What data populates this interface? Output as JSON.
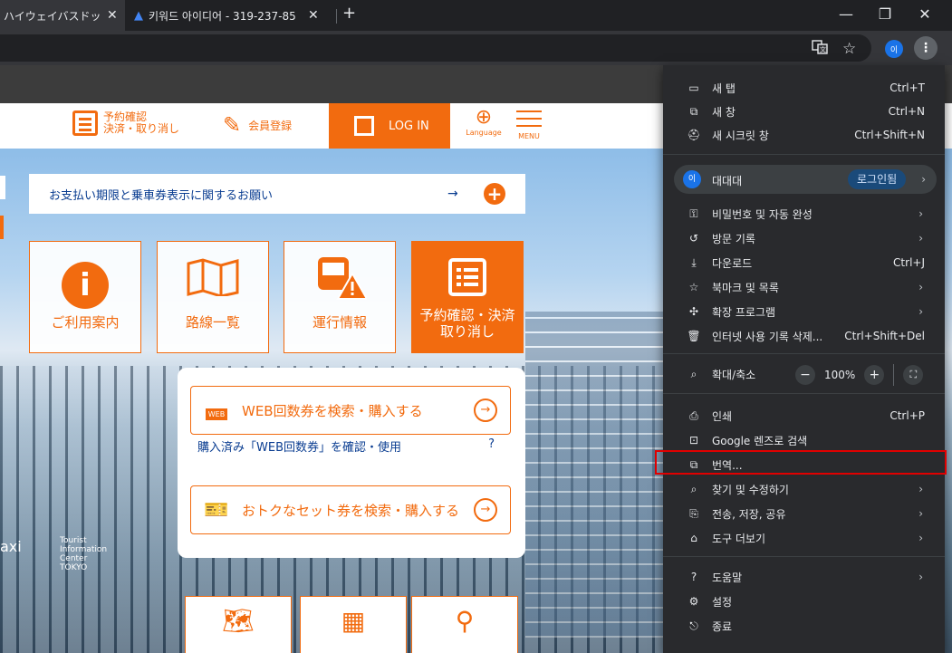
{
  "browser": {
    "tabs": [
      {
        "title": "ハイウェイバスドットコム",
        "close": "✕"
      },
      {
        "title": "키워드 아이디어 - 319-237-85",
        "close": "✕"
      }
    ],
    "new_tab": "+",
    "window": {
      "minimize": "—",
      "restore": "❐",
      "close": "✕"
    },
    "toolbar": {
      "translate_icon": "translate-icon",
      "star_icon": "star-icon",
      "avatar": "이",
      "menu": "⋮"
    }
  },
  "site": {
    "header": {
      "reserve_line1": "予約確認",
      "reserve_line2": "決済・取り消し",
      "member": "会員登録",
      "login": "LOG IN",
      "language": "Language",
      "menu": "MENU"
    },
    "notice": {
      "text": "お支払い期限と乗車券表示に関するお願い",
      "arrow": "→",
      "plus": "+"
    },
    "cards": [
      {
        "label": "ご利用案内",
        "icon": "i"
      },
      {
        "label": "路線一覧",
        "icon": "map-icon"
      },
      {
        "label": "運行情報",
        "icon": "bus-warning-icon"
      },
      {
        "label_line1": "予約確認・決済",
        "label_line2": "取り消し",
        "icon": "list-icon"
      }
    ],
    "panel": {
      "web_ticket": "WEB回数券を検索・購入する",
      "web_ticket_icon": "WEB",
      "purchased_link": "購入済み「WEB回数券」を確認・使用",
      "help": "?",
      "set_ticket": "おトクなセット券を検索・購入する",
      "go": "→"
    },
    "background_text": {
      "taxi": "axi",
      "tourist": "Tourist\nInformation\nCenter\nTOKYO"
    }
  },
  "context_menu": {
    "new_tab": {
      "label": "새 탭",
      "shortcut": "Ctrl+T"
    },
    "new_window": {
      "label": "새 창",
      "shortcut": "Ctrl+N"
    },
    "incognito": {
      "label": "새 시크릿 창",
      "shortcut": "Ctrl+Shift+N"
    },
    "profile": {
      "avatar": "이",
      "name": "대대대",
      "badge": "로그인됨",
      "chevron": "›"
    },
    "passwords": {
      "label": "비밀번호 및 자동 완성",
      "chevron": "›"
    },
    "history": {
      "label": "방문 기록",
      "chevron": "›"
    },
    "downloads": {
      "label": "다운로드",
      "shortcut": "Ctrl+J"
    },
    "bookmarks": {
      "label": "북마크 및 목록",
      "chevron": "›"
    },
    "extensions": {
      "label": "확장 프로그램",
      "chevron": "›"
    },
    "clear_data": {
      "label": "인터넷 사용 기록 삭제...",
      "shortcut": "Ctrl+Shift+Del"
    },
    "zoom": {
      "label": "확대/축소",
      "minus": "−",
      "value": "100%",
      "plus": "+",
      "fullscreen": "⛶"
    },
    "print": {
      "label": "인쇄",
      "shortcut": "Ctrl+P"
    },
    "lens": {
      "label": "Google 렌즈로 검색"
    },
    "translate": {
      "label": "번역..."
    },
    "find": {
      "label": "찾기 및 수정하기",
      "chevron": "›"
    },
    "cast": {
      "label": "전송, 저장, 공유",
      "chevron": "›"
    },
    "more_tools": {
      "label": "도구 더보기",
      "chevron": "›"
    },
    "help": {
      "label": "도움말",
      "chevron": "›"
    },
    "settings": {
      "label": "설정"
    },
    "exit": {
      "label": "종료"
    }
  }
}
